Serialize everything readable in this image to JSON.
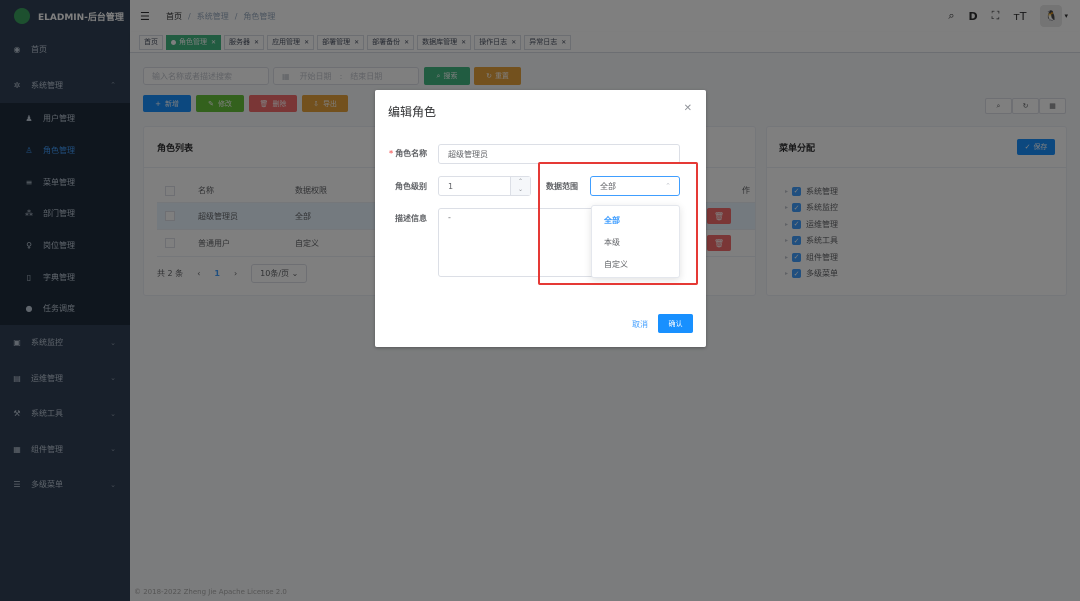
{
  "app": {
    "logo_text": "ELADMIN-后台管理",
    "brand_color": "#42b983"
  },
  "sidebar": {
    "items": [
      {
        "label": "首页",
        "icon": "dashboard-icon"
      },
      {
        "label": "系统管理",
        "icon": "gear-icon",
        "expanded": true,
        "children": [
          {
            "label": "用户管理",
            "icon": "users-icon"
          },
          {
            "label": "角色管理",
            "icon": "role-icon",
            "active": true
          },
          {
            "label": "菜单管理",
            "icon": "menu-list-icon"
          },
          {
            "label": "部门管理",
            "icon": "dept-icon"
          },
          {
            "label": "岗位管理",
            "icon": "job-icon"
          },
          {
            "label": "字典管理",
            "icon": "dictionary-icon"
          },
          {
            "label": "任务调度",
            "icon": "timer-icon"
          }
        ]
      },
      {
        "label": "系统监控",
        "icon": "monitor-icon"
      },
      {
        "label": "运维管理",
        "icon": "ops-icon"
      },
      {
        "label": "系统工具",
        "icon": "tools-icon"
      },
      {
        "label": "组件管理",
        "icon": "component-icon"
      },
      {
        "label": "多级菜单",
        "icon": "multi-menu-icon"
      }
    ]
  },
  "navbar": {
    "breadcrumb": [
      "首页",
      "系统管理",
      "角色管理"
    ],
    "separator": "/",
    "right_icons": [
      "search-icon",
      "doc-icon",
      "fullscreen-icon",
      "font-size-icon"
    ]
  },
  "tags": [
    {
      "label": "首页",
      "closable": false
    },
    {
      "label": "角色管理",
      "active": true
    },
    {
      "label": "服务器"
    },
    {
      "label": "应用管理"
    },
    {
      "label": "部署管理"
    },
    {
      "label": "部署备份"
    },
    {
      "label": "数据库管理"
    },
    {
      "label": "操作日志"
    },
    {
      "label": "异常日志"
    }
  ],
  "search": {
    "placeholder": "输入名称或者描述搜索",
    "date_start": "开始日期",
    "date_sep": ":",
    "date_end": "结束日期",
    "search_btn": "搜索",
    "reset_btn": "重置"
  },
  "toolbar": {
    "add": "新增",
    "edit": "修改",
    "delete": "删除",
    "export": "导出"
  },
  "role_card": {
    "title": "角色列表",
    "columns": [
      "名称",
      "数据权限",
      "",
      "",
      "作"
    ],
    "rows": [
      {
        "name": "超级管理员",
        "scope": "全部",
        "selected": true
      },
      {
        "name": "普通用户",
        "scope": "自定义"
      }
    ],
    "pagination": {
      "total": "共 2 条",
      "current": "1",
      "page_size": "10条/页"
    }
  },
  "menu_card": {
    "title": "菜单分配",
    "save": "保存",
    "tree": [
      "系统管理",
      "系统监控",
      "运维管理",
      "系统工具",
      "组件管理",
      "多级菜单"
    ]
  },
  "footer": "© 2018-2022 Zheng Jie Apache License 2.0",
  "dialog": {
    "title": "编辑角色",
    "name_label": "角色名称",
    "name_value": "超级管理员",
    "level_label": "角色级别",
    "level_value": "1",
    "scope_label": "数据范围",
    "scope_value": "全部",
    "desc_label": "描述信息",
    "desc_value": "-",
    "cancel": "取消",
    "confirm": "确认",
    "scope_options": [
      "全部",
      "本级",
      "自定义"
    ],
    "selected_option": "全部",
    "highlight_color": "#e53935"
  }
}
